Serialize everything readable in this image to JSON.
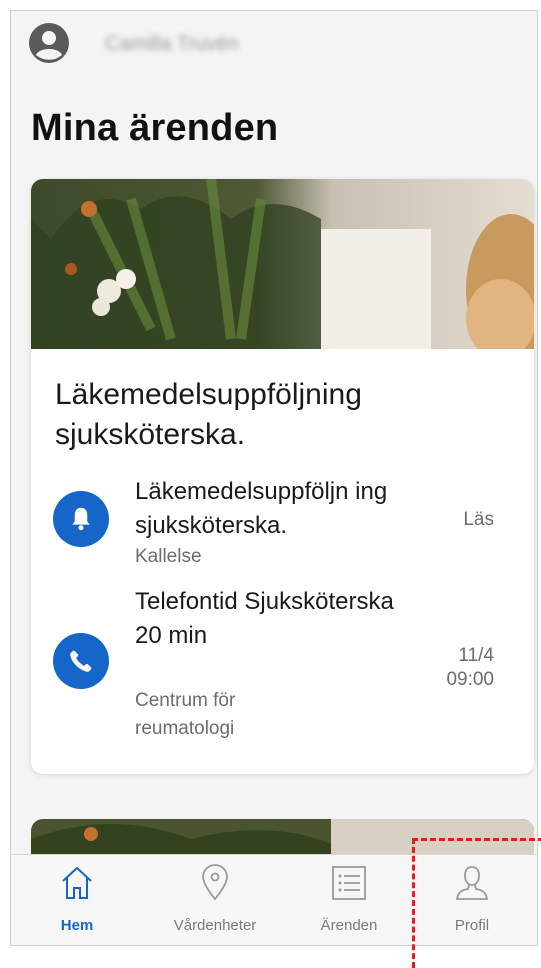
{
  "header": {
    "username": "Camilla Truvén",
    "avatar_icon": "user-avatar-icon"
  },
  "page": {
    "title": "Mina ärenden"
  },
  "card": {
    "title": "Läkemedelsuppföljning sjuksköterska.",
    "items": [
      {
        "icon": "bell-icon",
        "title": "Läkemedelsuppföljn ing sjuksköterska.",
        "subtitle": "Kallelse",
        "meta": "Läs"
      },
      {
        "icon": "phone-icon",
        "title": "Telefontid Sjuksköterska 20 min",
        "subtitle": "Centrum för reumatologi",
        "meta_date": "11/4",
        "meta_time": "09:00"
      }
    ]
  },
  "tabs": [
    {
      "label": "Hem",
      "icon": "home-icon",
      "active": true
    },
    {
      "label": "Vårdenheter",
      "icon": "location-pin-icon",
      "active": false
    },
    {
      "label": "Ärenden",
      "icon": "list-icon",
      "active": false
    },
    {
      "label": "Profil",
      "icon": "person-icon",
      "active": false
    }
  ],
  "colors": {
    "accent": "#1666c9",
    "highlight": "#e0211b",
    "text": "#1a1a1a",
    "muted": "#6b6b6b"
  }
}
